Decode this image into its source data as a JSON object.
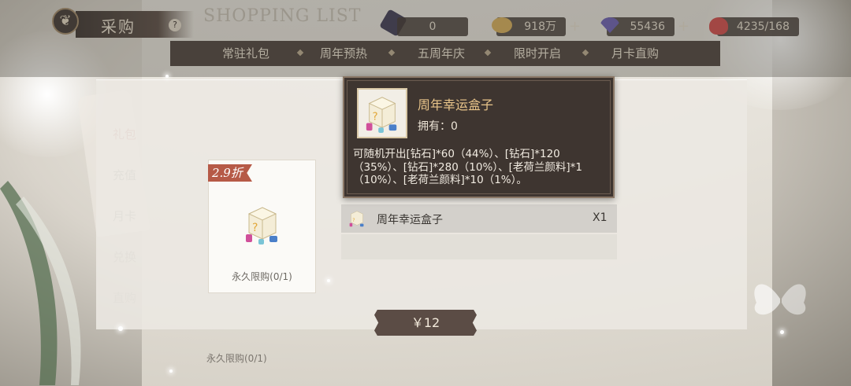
{
  "header": {
    "title": "采购",
    "help": "?",
    "shop_en": "SHOPPING LIST"
  },
  "resources": [
    {
      "name": "resource-1",
      "value": "0",
      "color": "#3c3a55"
    },
    {
      "name": "gold",
      "value": "918万",
      "color": "#d9b05a"
    },
    {
      "name": "diamond",
      "value": "55436",
      "color": "#6a5fb5"
    },
    {
      "name": "stamina",
      "value": "4235/168",
      "color": "#d44a4a"
    }
  ],
  "tabs": [
    "常驻礼包",
    "周年预热",
    "五周年庆",
    "限时开启",
    "月卡直购"
  ],
  "sidebar": [
    "礼包",
    "充值",
    "月卡",
    "兑换",
    "直购"
  ],
  "card": {
    "discount": "2.9折",
    "limit": "永久限购(0/1)"
  },
  "item": {
    "name": "周年幸运盒子",
    "qty": "X1"
  },
  "price": "￥12",
  "tooltip": {
    "name": "周年幸运盒子",
    "own": "拥有：0",
    "desc": "可随机开出[钻石]*60（44%）、[钻石]*120（35%）、[钻石]*280（10%）、[老荷兰颜料]*1（10%）、[老荷兰颜料]*10（1%）。"
  },
  "bottom_limit": "永久限购(0/1)",
  "colors": {
    "accent": "#5b4c45",
    "discount": "#b65a47",
    "tooltip_bg": "#3e3530",
    "tooltip_title": "#e9c58a"
  }
}
